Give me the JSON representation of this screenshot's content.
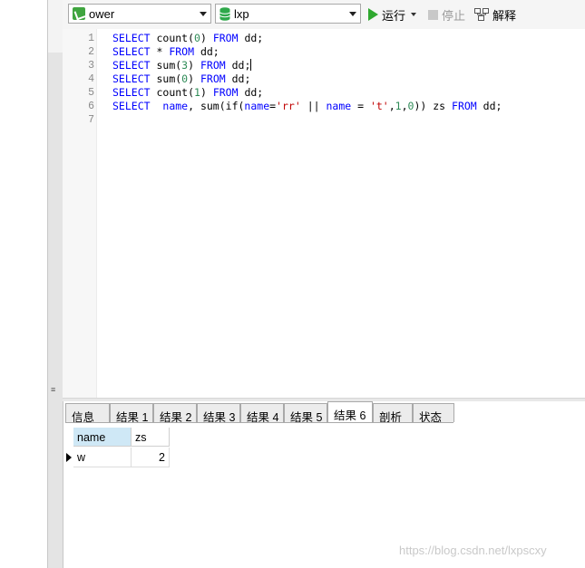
{
  "toolbar": {
    "connection": {
      "label": "ower",
      "icon": "connection-icon"
    },
    "database": {
      "label": "lxp",
      "icon": "database-icon"
    },
    "run_label": "运行",
    "stop_label": "停止",
    "explain_label": "解释"
  },
  "editor": {
    "line_numbers": [
      "1",
      "2",
      "3",
      "4",
      "5",
      "6",
      "7"
    ],
    "lines": [
      [
        {
          "t": "SELECT",
          "c": "kw"
        },
        {
          "t": " count("
        },
        {
          "t": "0",
          "c": "num"
        },
        {
          "t": ") "
        },
        {
          "t": "FROM",
          "c": "kw"
        },
        {
          "t": " dd;"
        }
      ],
      [
        {
          "t": "SELECT",
          "c": "kw"
        },
        {
          "t": " * "
        },
        {
          "t": "FROM",
          "c": "kw"
        },
        {
          "t": " dd;"
        }
      ],
      [
        {
          "t": "SELECT",
          "c": "kw"
        },
        {
          "t": " sum("
        },
        {
          "t": "3",
          "c": "num"
        },
        {
          "t": ") "
        },
        {
          "t": "FROM",
          "c": "kw"
        },
        {
          "t": " dd;"
        },
        {
          "caret": true
        }
      ],
      [
        {
          "t": "SELECT",
          "c": "kw"
        },
        {
          "t": " sum("
        },
        {
          "t": "0",
          "c": "num"
        },
        {
          "t": ") "
        },
        {
          "t": "FROM",
          "c": "kw"
        },
        {
          "t": " dd;"
        }
      ],
      [
        {
          "t": "SELECT",
          "c": "kw"
        },
        {
          "t": " count("
        },
        {
          "t": "1",
          "c": "num"
        },
        {
          "t": ") "
        },
        {
          "t": "FROM",
          "c": "kw"
        },
        {
          "t": " dd;"
        }
      ],
      [
        {
          "t": "SELECT",
          "c": "kw"
        },
        {
          "t": "  "
        },
        {
          "t": "name",
          "c": "kw"
        },
        {
          "t": ", sum(if("
        },
        {
          "t": "name",
          "c": "kw"
        },
        {
          "t": "="
        },
        {
          "t": "'rr'",
          "c": "str"
        },
        {
          "t": " || "
        },
        {
          "t": "name",
          "c": "kw"
        },
        {
          "t": " = "
        },
        {
          "t": "'t'",
          "c": "str"
        },
        {
          "t": ","
        },
        {
          "t": "1",
          "c": "num"
        },
        {
          "t": ","
        },
        {
          "t": "0",
          "c": "num"
        },
        {
          "t": ")) zs "
        },
        {
          "t": "FROM",
          "c": "kw"
        },
        {
          "t": " dd;"
        }
      ],
      []
    ]
  },
  "result_tabs": [
    "信息",
    "结果 1",
    "结果 2",
    "结果 3",
    "结果 4",
    "结果 5",
    "结果 6",
    "剖析",
    "状态"
  ],
  "active_tab": "结果 6",
  "grid": {
    "columns": [
      "name",
      "zs"
    ],
    "rows": [
      [
        "w",
        "2"
      ]
    ]
  },
  "watermark": "https://blog.csdn.net/lxpscxy",
  "colors": {
    "keyword": "#0000ff",
    "number": "#2e8b57",
    "string": "#c00000",
    "run_icon": "#2fa82f"
  }
}
